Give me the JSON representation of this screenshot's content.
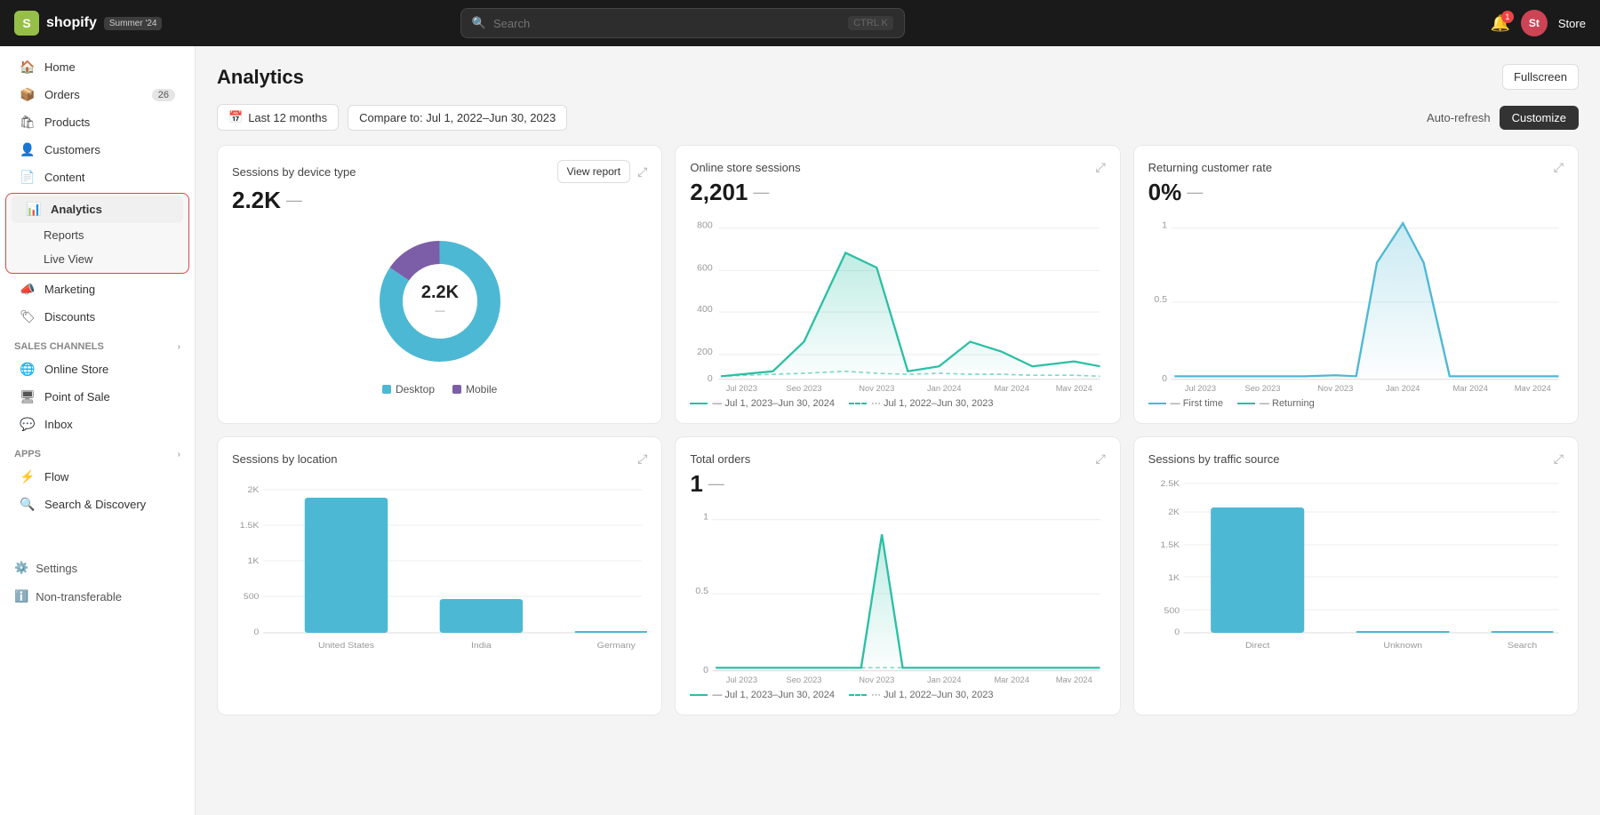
{
  "topnav": {
    "logo_letter": "S",
    "logo_name": "shopify",
    "badge": "Summer '24",
    "search_placeholder": "Search",
    "shortcut": "CTRL K",
    "store_label": "Store",
    "store_initials": "St"
  },
  "sidebar": {
    "main_items": [
      {
        "id": "home",
        "label": "Home",
        "icon": "🏠"
      },
      {
        "id": "orders",
        "label": "Orders",
        "icon": "📦",
        "badge": "26"
      },
      {
        "id": "products",
        "label": "Products",
        "icon": "🛍"
      },
      {
        "id": "customers",
        "label": "Customers",
        "icon": "👤"
      },
      {
        "id": "content",
        "label": "Content",
        "icon": "📄"
      },
      {
        "id": "analytics",
        "label": "Analytics",
        "icon": "📊",
        "active": true
      },
      {
        "id": "reports",
        "label": "Reports",
        "sub": true
      },
      {
        "id": "live-view",
        "label": "Live View",
        "sub": true
      },
      {
        "id": "marketing",
        "label": "Marketing",
        "icon": "📣"
      },
      {
        "id": "discounts",
        "label": "Discounts",
        "icon": "🏷"
      }
    ],
    "sales_channels_label": "Sales channels",
    "sales_channels": [
      {
        "id": "online-store",
        "label": "Online Store",
        "icon": "🌐"
      },
      {
        "id": "point-of-sale",
        "label": "Point of Sale",
        "icon": "🖥"
      },
      {
        "id": "inbox",
        "label": "Inbox",
        "icon": "💬"
      }
    ],
    "apps_label": "Apps",
    "apps": [
      {
        "id": "flow",
        "label": "Flow",
        "icon": "⚡"
      },
      {
        "id": "search-discovery",
        "label": "Search & Discovery",
        "icon": "🔍"
      }
    ],
    "settings_label": "Settings",
    "non_transferable": "Non-transferable"
  },
  "page": {
    "title": "Analytics",
    "fullscreen_label": "Fullscreen",
    "date_filter": "Last 12 months",
    "compare_filter": "Compare to: Jul 1, 2022–Jun 30, 2023",
    "auto_refresh_label": "Auto-refresh",
    "customize_label": "Customize"
  },
  "charts": {
    "sessions_by_device": {
      "title": "Sessions by device type",
      "value": "2.2K",
      "dash": "—",
      "view_report": "View report",
      "donut_desktop_pct": 85,
      "donut_mobile_pct": 15,
      "desktop_color": "#4db8d4",
      "mobile_color": "#7b5ea7",
      "desktop_label": "Desktop",
      "mobile_label": "Mobile"
    },
    "online_store_sessions": {
      "title": "Online store sessions",
      "value": "2,201",
      "dash": "—",
      "y_labels": [
        "0",
        "200",
        "400",
        "600",
        "800"
      ],
      "x_labels": [
        "Jul 2023",
        "Sep 2023",
        "Nov 2023",
        "Jan 2024",
        "Mar 2024",
        "May 2024"
      ],
      "line1_label": "— Jul 1, 2023–Jun 30, 2024",
      "line2_label": "··· Jul 1, 2022–Jun 30, 2023",
      "line_color": "#2bbfa4"
    },
    "returning_customer_rate": {
      "title": "Returning customer rate",
      "value": "0%",
      "dash": "—",
      "y_labels": [
        "0",
        "0.5",
        "1"
      ],
      "x_labels": [
        "Jul 2023",
        "Sep 2023",
        "Nov 2023",
        "Jan 2024",
        "Mar 2024",
        "May 2024"
      ],
      "line1_label": "— First time",
      "line2_label": "— Returning",
      "line_color": "#4db8d4"
    },
    "sessions_by_location": {
      "title": "Sessions by location",
      "y_labels": [
        "0",
        "500",
        "1K",
        "1.5K",
        "2K"
      ],
      "x_labels": [
        "United States",
        "India",
        "Germany"
      ],
      "bar_color": "#4db8d4",
      "bars": [
        {
          "label": "United States",
          "value": 1900
        },
        {
          "label": "India",
          "value": 480
        },
        {
          "label": "Germany",
          "value": 0
        }
      ]
    },
    "total_orders": {
      "title": "Total orders",
      "value": "1",
      "dash": "—",
      "y_labels": [
        "0",
        "0.5",
        "1"
      ],
      "x_labels": [
        "Jul 2023",
        "Sep 2023",
        "Nov 2023",
        "Jan 2024",
        "Mar 2024",
        "May 2024"
      ],
      "line1_label": "— Jul 1, 2023–Jun 30, 2024",
      "line2_label": "··· Jul 1, 2022–Jun 30, 2023",
      "line_color": "#2bbfa4"
    },
    "sessions_by_traffic": {
      "title": "Sessions by traffic source",
      "y_labels": [
        "0",
        "500",
        "1K",
        "1.5K",
        "2K",
        "2.5K"
      ],
      "x_labels": [
        "Direct",
        "Unknown",
        "Search"
      ],
      "bar_color": "#4db8d4",
      "bars": [
        {
          "label": "Direct",
          "value": 2100
        },
        {
          "label": "Unknown",
          "value": 0
        },
        {
          "label": "Search",
          "value": 0
        }
      ]
    }
  }
}
